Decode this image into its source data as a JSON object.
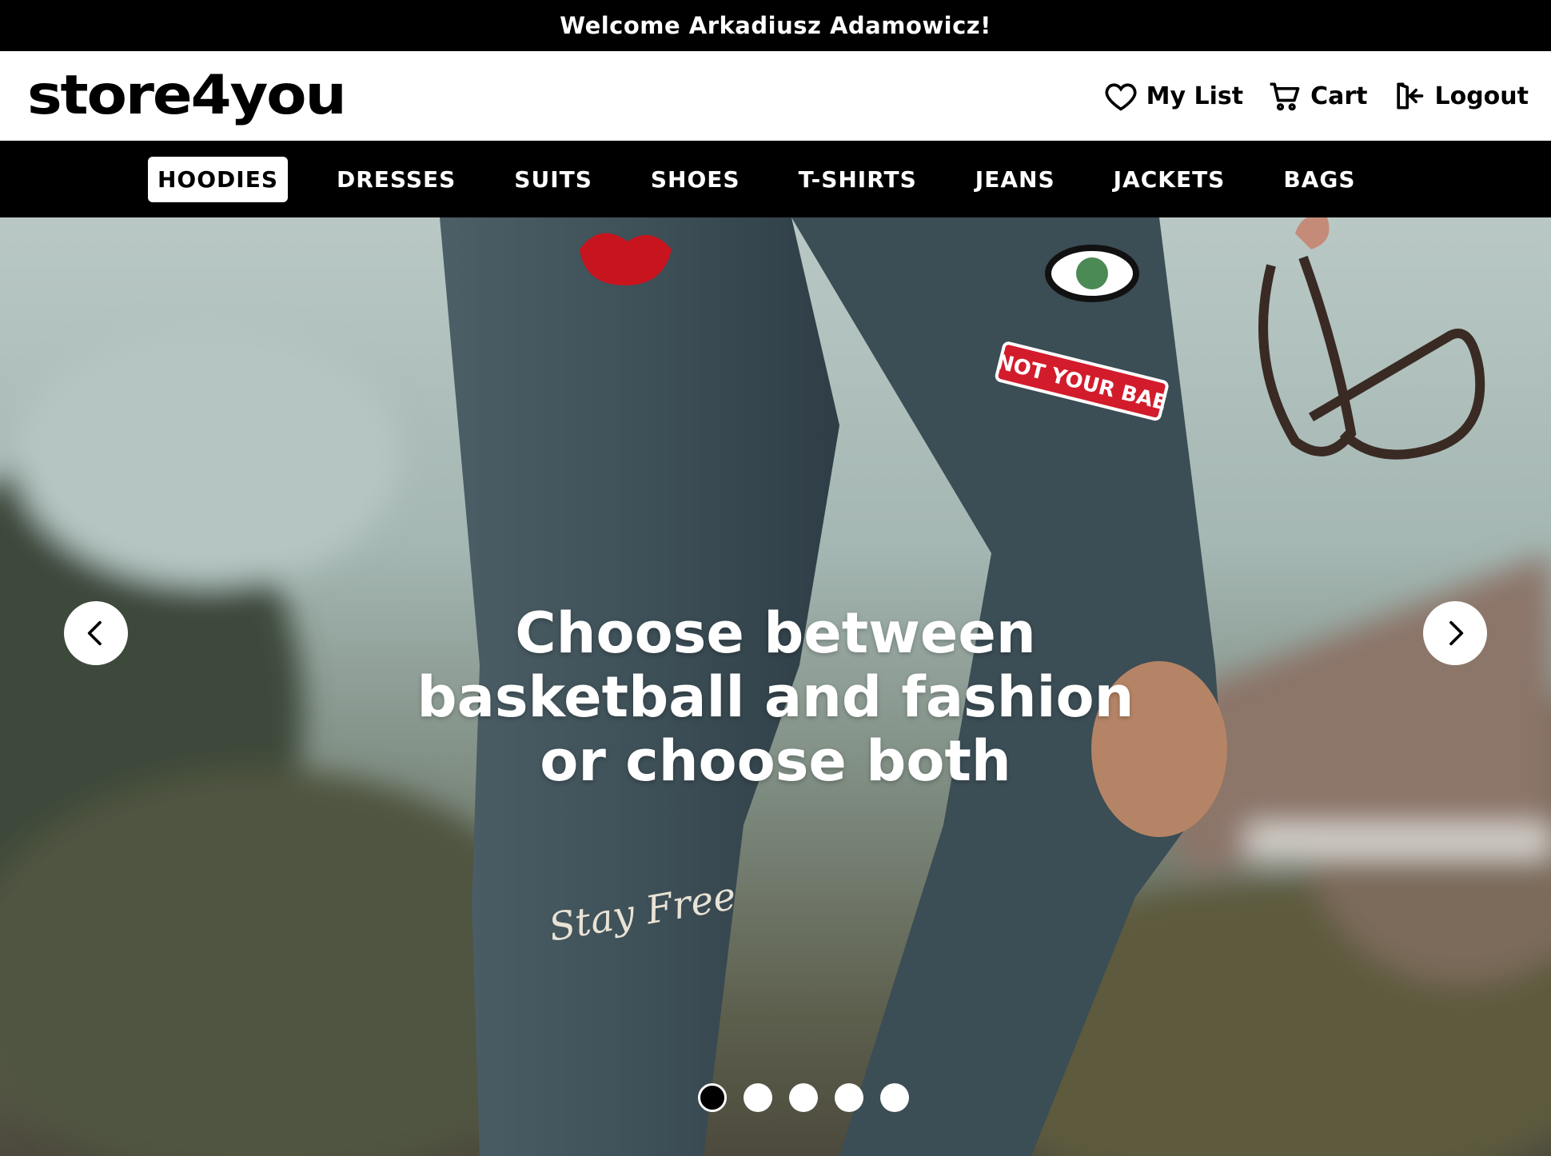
{
  "topbar": {
    "welcome": "Welcome Arkadiusz Adamowicz!"
  },
  "header": {
    "logo": "store4you",
    "actions": [
      {
        "label": "My List",
        "icon": "heart-icon"
      },
      {
        "label": "Cart",
        "icon": "cart-icon"
      },
      {
        "label": "Logout",
        "icon": "logout-icon"
      }
    ]
  },
  "nav": {
    "items": [
      {
        "label": "HOODIES",
        "active": true
      },
      {
        "label": "DRESSES"
      },
      {
        "label": "SUITS"
      },
      {
        "label": "SHOES"
      },
      {
        "label": "T-SHIRTS"
      },
      {
        "label": "JEANS"
      },
      {
        "label": "JACKETS"
      },
      {
        "label": "BAGS"
      }
    ]
  },
  "hero": {
    "headline_lines": [
      "Choose between",
      "basketball and fashion",
      "or choose both"
    ],
    "patch_text": "NOT YOUR BAE",
    "embroidery_text": "Stay Free",
    "slides_count": 5,
    "active_slide": 1
  },
  "colors": {
    "bar": "#000000",
    "surface": "#ffffff",
    "lip_patch": "#c8141e",
    "patch_red": "#d21c2c"
  }
}
